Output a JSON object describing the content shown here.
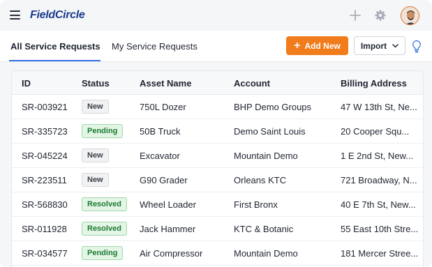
{
  "app": {
    "logo_text": "FieldCircle",
    "colors": {
      "brand": "#1a3b8f",
      "accent": "#f07c1b",
      "tab_active": "#2f6fe0"
    }
  },
  "tabs": [
    {
      "label": "All Service Requests",
      "active": true
    },
    {
      "label": "My Service Requests",
      "active": false
    }
  ],
  "toolbar": {
    "add_label": "Add New",
    "import_label": "Import"
  },
  "table": {
    "columns": [
      "ID",
      "Status",
      "Asset Name",
      "Account",
      "Billing Address"
    ],
    "rows": [
      {
        "id": "SR-003921",
        "status": "New",
        "asset": "750L Dozer",
        "account": "BHP Demo Groups",
        "address": "47 W 13th St, Ne..."
      },
      {
        "id": "SR-335723",
        "status": "Pending",
        "asset": "50B Truck",
        "account": "Demo Saint Louis",
        "address": "20 Cooper Squ..."
      },
      {
        "id": "SR-045224",
        "status": "New",
        "asset": "Excavator",
        "account": "Mountain Demo",
        "address": "1 E 2nd St, New..."
      },
      {
        "id": "SR-223511",
        "status": "New",
        "asset": "G90 Grader",
        "account": "Orleans KTC",
        "address": "721 Broadway, N..."
      },
      {
        "id": "SR-568830",
        "status": "Resolved",
        "asset": "Wheel Loader",
        "account": "First Bronx",
        "address": "40 E 7th St, New..."
      },
      {
        "id": "SR-011928",
        "status": "Resolved",
        "asset": "Jack Hammer",
        "account": "KTC & Botanic",
        "address": "55 East 10th Stre..."
      },
      {
        "id": "SR-034577",
        "status": "Pending",
        "asset": "Air Compressor",
        "account": "Mountain Demo",
        "address": "181 Mercer Stree..."
      }
    ]
  },
  "icons": {
    "menu": "hamburger-icon",
    "add": "plus-icon",
    "settings": "gear-icon",
    "user": "avatar",
    "help": "lightbulb-icon",
    "dropdown": "chevron-down-icon"
  }
}
